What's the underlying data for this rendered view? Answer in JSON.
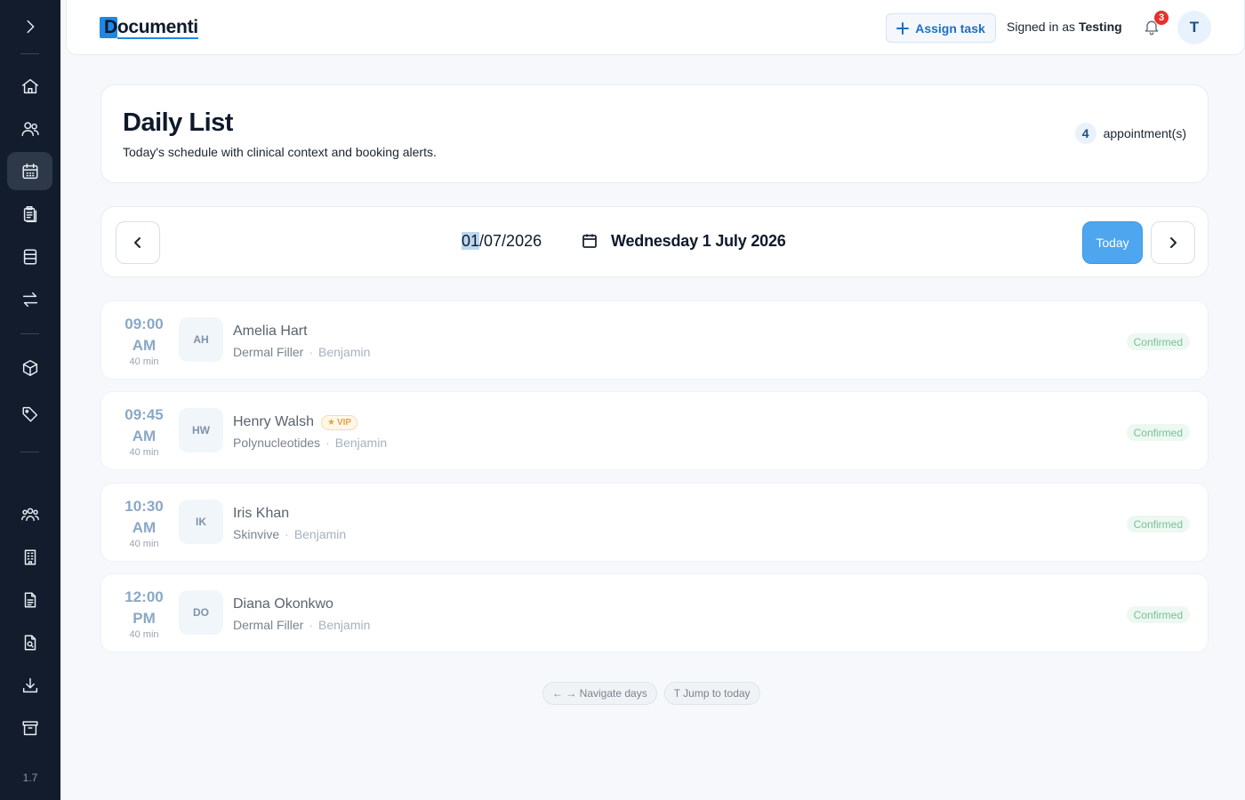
{
  "app": {
    "logo_text": "Documenti",
    "version": "1.7",
    "brand_color": "#1e88e5"
  },
  "sidebar": {
    "items": [
      {
        "icon": "chevron-right-icon"
      },
      {
        "icon": "home-icon"
      },
      {
        "icon": "users-icon"
      },
      {
        "icon": "calendar-icon",
        "active": true
      },
      {
        "icon": "clipboard-icon"
      },
      {
        "icon": "panel-icon"
      },
      {
        "icon": "transfer-icon"
      },
      {
        "icon": "cube-icon"
      },
      {
        "icon": "tag-icon"
      },
      {
        "icon": "team-icon"
      },
      {
        "icon": "building-icon"
      },
      {
        "icon": "document-icon"
      },
      {
        "icon": "document-search-icon"
      },
      {
        "icon": "download-icon"
      },
      {
        "icon": "archive-icon"
      }
    ]
  },
  "header": {
    "assign_task_label": "Assign task",
    "signed_in_prefix": "Signed in as",
    "signed_in_user": "Testing",
    "notification_count": "3",
    "avatar_initial": "T"
  },
  "page": {
    "title": "Daily List",
    "subtitle": "Today's schedule with clinical context and booking alerts.",
    "appointment_count": "4",
    "appointment_label": "appointment(s)"
  },
  "date_nav": {
    "date_day": "01",
    "date_rest": "/07/2026",
    "date_long": "Wednesday 1 July 2026",
    "today_label": "Today"
  },
  "appointments": [
    {
      "time": "09:00",
      "period": "AM",
      "duration": "40 min",
      "initials": "AH",
      "name": "Amelia Hart",
      "treatment": "Dermal Filler",
      "staff": "Benjamin",
      "status": "Confirmed",
      "vip": ""
    },
    {
      "time": "09:45",
      "period": "AM",
      "duration": "40 min",
      "initials": "HW",
      "name": "Henry Walsh",
      "treatment": "Polynucleotides",
      "staff": "Benjamin",
      "status": "Confirmed",
      "vip": "VIP"
    },
    {
      "time": "10:30",
      "period": "AM",
      "duration": "40 min",
      "initials": "IK",
      "name": "Iris Khan",
      "treatment": "Skinvive",
      "staff": "Benjamin",
      "status": "Confirmed",
      "vip": ""
    },
    {
      "time": "12:00",
      "period": "PM",
      "duration": "40 min",
      "initials": "DO",
      "name": "Diana Okonkwo",
      "treatment": "Dermal Filler",
      "staff": "Benjamin",
      "status": "Confirmed",
      "vip": ""
    }
  ],
  "hints": {
    "navigate": "← → Navigate days",
    "jump": "T Jump to today"
  }
}
